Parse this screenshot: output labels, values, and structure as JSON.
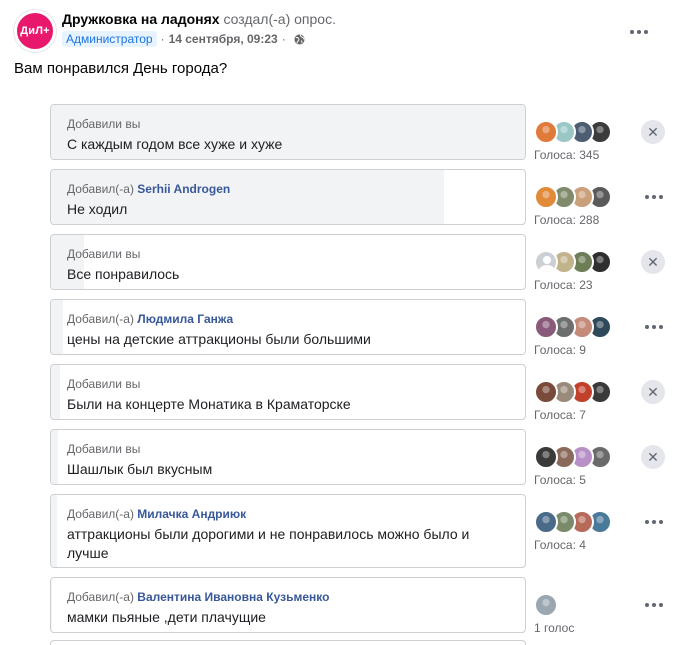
{
  "post": {
    "group_name": "Дружковка на ладонях",
    "action": " создал(-а) опрос.",
    "avatar_text": "ДиЛ+",
    "role_badge": "Администратор",
    "separator": "·",
    "time": "14 сентября, 09:23",
    "question": "Вам понравился День города?"
  },
  "icons": {
    "more": "more-horizontal-icon",
    "close": "close-icon",
    "privacy": "globe-icon"
  },
  "colors": {
    "accent": "#1b74e4",
    "author_link": "#385898",
    "fill": "#f2f3f5",
    "group_avatar": "#e8186d"
  },
  "options": [
    {
      "added_prefix": "Добавили вы",
      "author": "",
      "text": "С каждым годом все хуже и хуже",
      "votes_label": "Голоса: 345",
      "fill_fraction": 1.0,
      "control": "close",
      "voters": [
        "#e07a3a",
        "#9ac7c6",
        "#4c5d72",
        "#3b3b3b"
      ]
    },
    {
      "added_prefix": "Добавил(-а) ",
      "author": "Serhii Androgen",
      "text": "Не ходил",
      "votes_label": "Голоса: 288",
      "fill_fraction": 0.83,
      "control": "more",
      "voters": [
        "#e08a3a",
        "#7f8b6a",
        "#c9a07a",
        "#5a5a5a"
      ]
    },
    {
      "added_prefix": "Добавили вы",
      "author": "",
      "text": "Все понравилось",
      "votes_label": "Голоса: 23",
      "fill_fraction": 0.07,
      "control": "close",
      "voters": [
        "silhouette",
        "#c2b48a",
        "#6d7d55",
        "#2f2f2f"
      ]
    },
    {
      "added_prefix": "Добавил(-а) ",
      "author": "Людмила Ганжа",
      "text": "цены на детские аттракционы были большими",
      "votes_label": "Голоса: 9",
      "fill_fraction": 0.026,
      "control": "more",
      "voters": [
        "#8a5a7a",
        "#6e6e6e",
        "#c48a7a",
        "#2e4a5a"
      ]
    },
    {
      "added_prefix": "Добавили вы",
      "author": "",
      "text": "Были на концерте Монатика в Краматорске",
      "votes_label": "Голоса: 7",
      "fill_fraction": 0.02,
      "control": "close",
      "voters": [
        "#7a4a3a",
        "#9a8a7a",
        "#c0402a",
        "#3a3a3a"
      ]
    },
    {
      "added_prefix": "Добавили вы",
      "author": "",
      "text": "Шашлык был вкусным",
      "votes_label": "Голоса: 5",
      "fill_fraction": 0.015,
      "control": "close",
      "voters": [
        "#3a3a3a",
        "#8a6a5a",
        "#b890c8",
        "#6a6a6a"
      ]
    },
    {
      "added_prefix": "Добавил(-а) ",
      "author": "Милачка Андриюк",
      "text": "аттракционы были дорогими и не понравилось можно было и лучше",
      "votes_label": "Голоса: 4",
      "fill_fraction": 0.012,
      "control": "more",
      "voters": [
        "#4a6a8a",
        "#7a8a6a",
        "#b86a5a",
        "#4a7a9a"
      ]
    },
    {
      "added_prefix": "Добавил(-а) ",
      "author": "Валентина Ивановна Кузьменко",
      "text": "мамки пьяные ,дети плачущие",
      "votes_label": "1 голос",
      "fill_fraction": 0.003,
      "control": "more",
      "voters": [
        "#9aa7b0"
      ]
    }
  ]
}
